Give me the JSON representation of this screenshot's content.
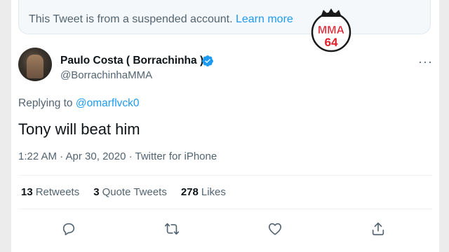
{
  "banner": {
    "text": "This Tweet is from a suspended account.",
    "link": "Learn more"
  },
  "watermark": {
    "top": "MMA",
    "bottom": "64",
    "color": "#e11d2a"
  },
  "tweet": {
    "author_name": "Paulo Costa ( Borrachinha )",
    "author_handle": "@BorrachinhaMMA",
    "replying_prefix": "Replying to",
    "replying_to": "@omarflvck0",
    "text": "Tony will beat him",
    "timestamp": "1:22 AM · Apr 30, 2020 · Twitter for iPhone",
    "more_icon": "···"
  },
  "stats": [
    {
      "count": "13",
      "label": "Retweets"
    },
    {
      "count": "3",
      "label": "Quote Tweets"
    },
    {
      "count": "278",
      "label": "Likes"
    }
  ],
  "actions": {
    "reply": "reply-icon",
    "retweet": "retweet-icon",
    "like": "heart-icon",
    "share": "share-icon"
  },
  "colors": {
    "accent": "#1d9bf0",
    "muted": "#536471",
    "text": "#0f1419"
  }
}
